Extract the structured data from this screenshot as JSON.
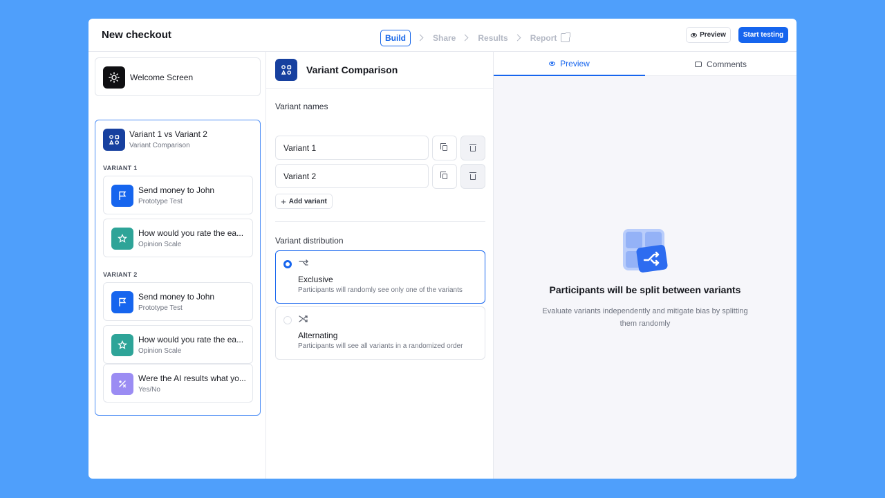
{
  "header": {
    "title": "New checkout",
    "steps": [
      "Build",
      "Share",
      "Results",
      "Report"
    ],
    "preview_label": "Preview",
    "start_label": "Start testing"
  },
  "left": {
    "welcome": {
      "title": "Welcome Screen",
      "icon": "sun-icon"
    },
    "group": {
      "title": "Variant 1 vs Variant 2",
      "subtitle": "Variant Comparison",
      "icon": "variant-icon"
    },
    "variant1": {
      "label": "VARIANT 1",
      "items": [
        {
          "title": "Send money to John",
          "subtitle": "Prototype Test",
          "icon": "flag-icon"
        },
        {
          "title": "How would you rate the ea...",
          "subtitle": "Opinion Scale",
          "icon": "star-icon"
        }
      ]
    },
    "variant2": {
      "label": "VARIANT 2",
      "items": [
        {
          "title": "Send money to John",
          "subtitle": "Prototype Test",
          "icon": "flag-icon"
        },
        {
          "title": "How would you rate the ea...",
          "subtitle": "Opinion Scale",
          "icon": "star-icon"
        },
        {
          "title": "Were the AI results what yo...",
          "subtitle": "Yes/No",
          "icon": "percent-icon"
        }
      ]
    }
  },
  "middle": {
    "title": "Variant Comparison",
    "names_label": "Variant names",
    "variants": [
      {
        "value": "Variant 1"
      },
      {
        "value": "Variant 2"
      }
    ],
    "add_label": "Add variant",
    "distribution_label": "Variant distribution",
    "options": [
      {
        "title": "Exclusive",
        "desc": "Participants will randomly see only one of the variants",
        "selected": true
      },
      {
        "title": "Alternating",
        "desc": "Participants will see all variants in a randomized order",
        "selected": false
      }
    ]
  },
  "right": {
    "tabs": [
      "Preview",
      "Comments"
    ],
    "empty_title": "Participants will be split between variants",
    "empty_desc": "Evaluate variants independently and mitigate bias by splitting them randomly"
  },
  "colors": {
    "accent": "#1665ee",
    "background": "#4f9ffb"
  }
}
